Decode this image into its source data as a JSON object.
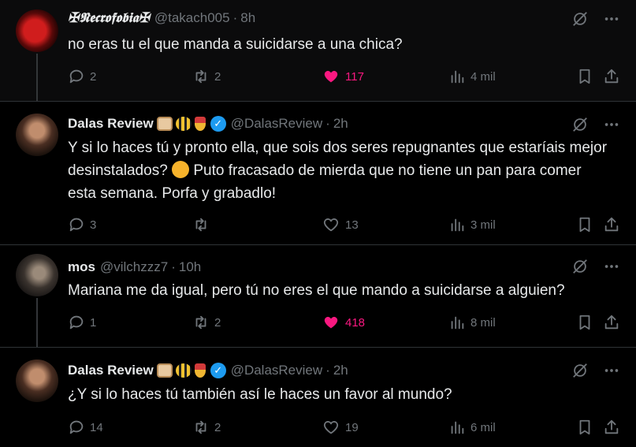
{
  "tweets": [
    {
      "name": "✠𝕹𝖊𝖈𝖗𝖔𝖋𝖔𝖇𝖎𝖆✠",
      "handle": "@takach005",
      "time": "8h",
      "text": "no eras tu el que manda a suicidarse a una chica?",
      "replies": "2",
      "retweets": "2",
      "likes": "117",
      "liked": true,
      "views": "4 mil"
    },
    {
      "name": "Dalas Review",
      "handle": "@DalasReview",
      "time": "2h",
      "text_a": "Y si lo haces tú y pronto ella, que sois dos seres repugnantes que estaríais mejor desinstalados?",
      "text_b": "Puto fracasado de mierda que no tiene un pan para comer esta semana. Porfa y grabadlo!",
      "replies": "3",
      "retweets": "",
      "likes": "13",
      "liked": false,
      "views": "3 mil"
    },
    {
      "name": "mos",
      "handle": "@vilchzzz7",
      "time": "10h",
      "text": "Mariana me da igual, pero tú no eres el que mando a suicidarse a alguien?",
      "replies": "1",
      "retweets": "2",
      "likes": "418",
      "liked": true,
      "views": "8 mil"
    },
    {
      "name": "Dalas Review",
      "handle": "@DalasReview",
      "time": "2h",
      "text": "¿Y si lo haces tú también así le haces un favor al mundo?",
      "replies": "14",
      "retweets": "2",
      "likes": "19",
      "liked": false,
      "views": "6 mil"
    }
  ],
  "separator_dot": "·",
  "colors": {
    "like_active": "#f91880",
    "muted": "#71767b",
    "verified": "#1d9bf0"
  },
  "icons": [
    "grok-icon",
    "more-icon",
    "reply-icon",
    "retweet-icon",
    "like-icon",
    "views-icon",
    "bookmark-icon",
    "share-icon",
    "verified-badge-icon"
  ]
}
